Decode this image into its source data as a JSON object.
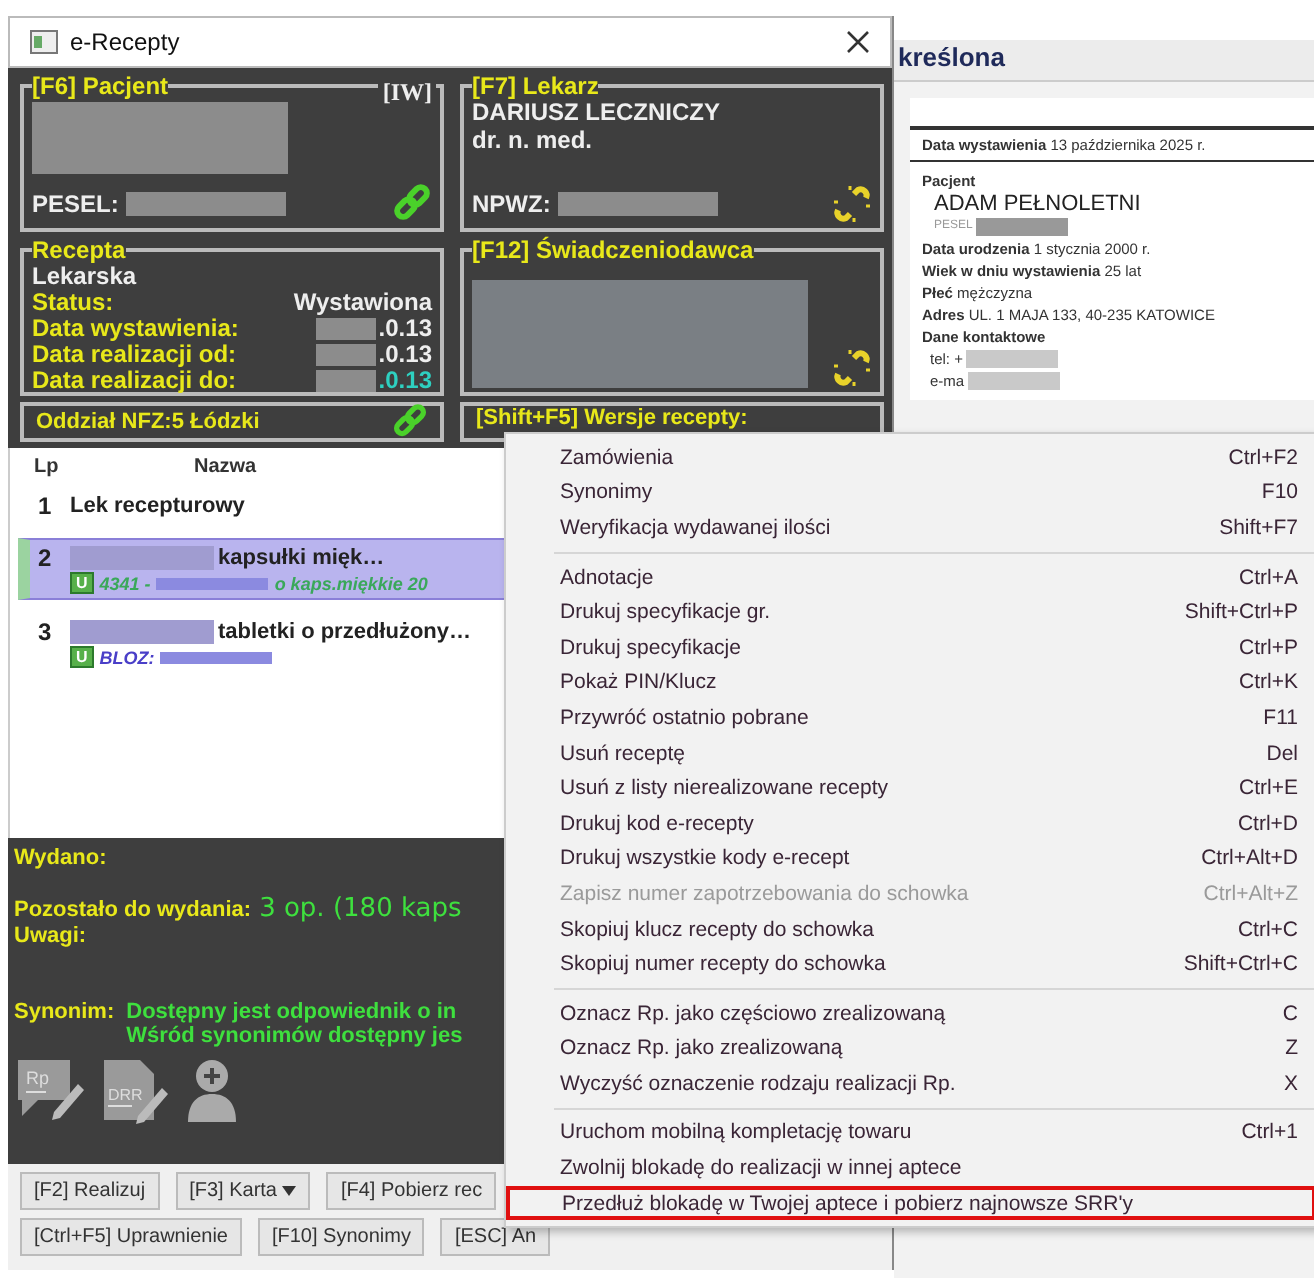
{
  "window": {
    "title": "e-Recepty"
  },
  "patient_panel": {
    "title": "[F6] Pacjent",
    "tag": "[IW]",
    "pesel_label": "PESEL:",
    "linked": true
  },
  "doctor_panel": {
    "title": "[F7] Lekarz",
    "name": "DARIUSZ LECZNICZY",
    "degree": "dr. n. med.",
    "npwz_label": "NPWZ:",
    "linked": false
  },
  "prescription_panel": {
    "title": "Recepta",
    "type": "Lekarska",
    "fields": [
      {
        "label": "Status:",
        "value": "Wystawiona",
        "redacted": false,
        "highlighted": false
      },
      {
        "label": "Data wystawienia:",
        "value": ".0.13",
        "redacted": true,
        "highlighted": false
      },
      {
        "label": "Data realizacji od:",
        "value": ".0.13",
        "redacted": true,
        "highlighted": false
      },
      {
        "label": "Data realizacji do:",
        "value": ".0.13",
        "redacted": true,
        "highlighted": true
      }
    ]
  },
  "provider_panel": {
    "title": "[F12] Świadczeniodawca",
    "linked": false
  },
  "nfz_panel": {
    "text": "Oddział NFZ:5 Łódzki",
    "linked": true
  },
  "versions_panel": {
    "title": "[Shift+F5] Wersje recepty:"
  },
  "list": {
    "columns": [
      "Lp",
      "Nazwa"
    ],
    "rows": [
      {
        "lp": "1",
        "name": "Lek recepturowy",
        "redacted": false,
        "selected": false
      },
      {
        "lp": "2",
        "name": "kapsułki mięk…",
        "redacted": true,
        "badge": "U",
        "detail": "4341 -",
        "detail_end": "o kaps.miękkie 20",
        "color": "#3aa85a",
        "selected": true
      },
      {
        "lp": "3",
        "name": "tabletki o przedłużony…",
        "redacted": true,
        "badge": "U",
        "detail": "BLOZ:",
        "color": "#4a3fc8",
        "selected": false
      }
    ]
  },
  "summary": {
    "issued_label": "Wydano:",
    "remaining_label": "Pozostało do wydania:",
    "remaining_value": "3 op. (180 kaps",
    "notes_label": "Uwagi:",
    "synonym_label": "Synonim:",
    "synonym_lines": [
      "Dostępny jest odpowiednik o in",
      "Wśród synonimów dostępny jes"
    ]
  },
  "tools": [
    {
      "kind": "rp",
      "label": "Rp"
    },
    {
      "kind": "drr",
      "label": "DRR"
    },
    {
      "kind": "pharmacist"
    }
  ],
  "buttons": [
    [
      {
        "label": "[F2] Realizuj",
        "dropdown": false
      },
      {
        "label": "[F3] Karta",
        "dropdown": true
      },
      {
        "label": "[F4] Pobierz rec",
        "dropdown": false
      }
    ],
    [
      {
        "label": "[Ctrl+F5] Uprawnienie",
        "dropdown": false
      },
      {
        "label": "[F10] Synonimy",
        "dropdown": false
      },
      {
        "label": "[ESC] An",
        "dropdown": false
      }
    ]
  ],
  "document": {
    "header": "kreślona",
    "date": {
      "label": "Data wystawienia",
      "value": "13 października 2025 r."
    },
    "section": "Pacjent",
    "patient_name": "ADAM PEŁNOLETNI",
    "pesel_label": "PESEL",
    "fields": [
      {
        "label": "Data urodzenia",
        "value": "1 stycznia 2000 r."
      },
      {
        "label": "Wiek w dniu wystawienia",
        "value": "25 lat"
      },
      {
        "label": "Płeć",
        "value": "mężczyzna"
      },
      {
        "label": "Adres",
        "value": "UL. 1 MAJA 133, 40-235 KATOWICE"
      }
    ],
    "contact_title": "Dane kontaktowe",
    "contacts": [
      "tel: +",
      "e-ma"
    ]
  },
  "context_menu": [
    {
      "kind": "item",
      "label": "Zamówienia",
      "shortcut": "Ctrl+F2",
      "disabled": false,
      "highlighted": false
    },
    {
      "kind": "item",
      "label": "Synonimy",
      "shortcut": "F10",
      "disabled": false,
      "highlighted": false
    },
    {
      "kind": "item",
      "label": "Weryfikacja wydawanej ilości",
      "shortcut": "Shift+F7",
      "disabled": false,
      "highlighted": false
    },
    {
      "kind": "separator"
    },
    {
      "kind": "item",
      "label": "Adnotacje",
      "shortcut": "Ctrl+A",
      "disabled": false,
      "highlighted": false
    },
    {
      "kind": "item",
      "label": "Drukuj specyfikacje gr.",
      "shortcut": "Shift+Ctrl+P",
      "disabled": false,
      "highlighted": false
    },
    {
      "kind": "item",
      "label": "Drukuj specyfikacje",
      "shortcut": "Ctrl+P",
      "disabled": false,
      "highlighted": false
    },
    {
      "kind": "item",
      "label": "Pokaż PIN/Klucz",
      "shortcut": "Ctrl+K",
      "disabled": false,
      "highlighted": false
    },
    {
      "kind": "item",
      "label": "Przywróć ostatnio pobrane",
      "shortcut": "F11",
      "disabled": false,
      "highlighted": false
    },
    {
      "kind": "item",
      "label": "Usuń receptę",
      "shortcut": "Del",
      "disabled": false,
      "highlighted": false
    },
    {
      "kind": "item",
      "label": "Usuń z listy nierealizowane recepty",
      "shortcut": "Ctrl+E",
      "disabled": false,
      "highlighted": false
    },
    {
      "kind": "item",
      "label": "Drukuj kod e-recepty",
      "shortcut": "Ctrl+D",
      "disabled": false,
      "highlighted": false
    },
    {
      "kind": "item",
      "label": "Drukuj wszystkie kody e-recept",
      "shortcut": "Ctrl+Alt+D",
      "disabled": false,
      "highlighted": false
    },
    {
      "kind": "item",
      "label": "Zapisz numer zapotrzebowania do schowka",
      "shortcut": "Ctrl+Alt+Z",
      "disabled": true,
      "highlighted": false
    },
    {
      "kind": "item",
      "label": "Skopiuj klucz recepty do schowka",
      "shortcut": "Ctrl+C",
      "disabled": false,
      "highlighted": false
    },
    {
      "kind": "item",
      "label": "Skopiuj numer recepty do schowka",
      "shortcut": "Shift+Ctrl+C",
      "disabled": false,
      "highlighted": false
    },
    {
      "kind": "separator"
    },
    {
      "kind": "item",
      "label": "Oznacz Rp. jako częściowo zrealizowaną",
      "shortcut": "C",
      "disabled": false,
      "highlighted": false
    },
    {
      "kind": "item",
      "label": "Oznacz Rp. jako zrealizowaną",
      "shortcut": "Z",
      "disabled": false,
      "highlighted": false
    },
    {
      "kind": "item",
      "label": "Wyczyść oznaczenie rodzaju realizacji Rp.",
      "shortcut": "X",
      "disabled": false,
      "highlighted": false
    },
    {
      "kind": "separator"
    },
    {
      "kind": "item",
      "label": "Uruchom mobilną kompletację towaru",
      "shortcut": "Ctrl+1",
      "disabled": false,
      "highlighted": false
    },
    {
      "kind": "item",
      "label": "Zwolnij blokadę do realizacji w innej aptece",
      "disabled": false,
      "highlighted": false
    },
    {
      "kind": "item",
      "label": "Przedłuż blokadę w Twojej aptece i pobierz najnowsze SRR'y",
      "disabled": false,
      "highlighted": true
    }
  ]
}
